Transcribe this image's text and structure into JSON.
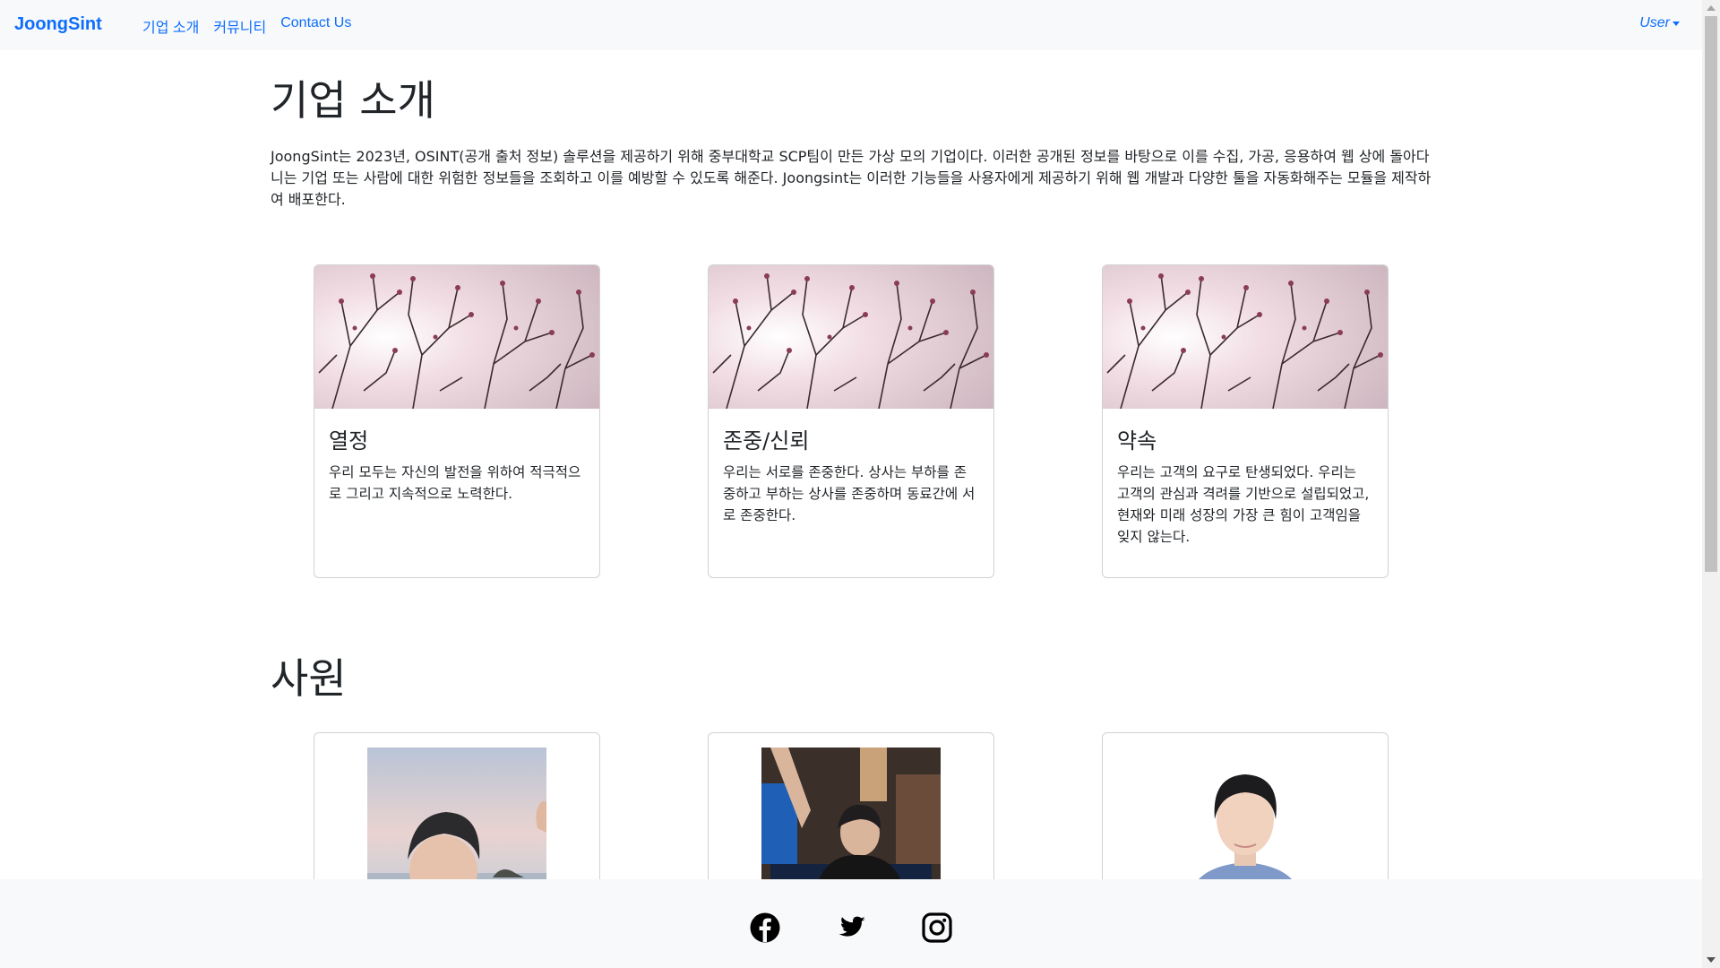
{
  "navbar": {
    "brand": "JoongSint",
    "links": [
      "기업 소개",
      "커뮤니티",
      "Contact Us"
    ],
    "user_label": "User"
  },
  "about": {
    "title": "기업 소개",
    "intro": "JoongSint는 2023년, OSINT(공개 출처 정보) 솔루션을 제공하기 위해 중부대학교 SCP팀이 만든 가상 모의 기업이다. 이러한 공개된 정보를 바탕으로 이를 수집, 가공, 응용하여 웹 상에 돌아다니는 기업 또는 사람에 대한 위험한 정보들을 조회하고 이를 예방할 수 있도록 해준다. Joongsint는 이러한 기능들을 사용자에게 제공하기 위해 웹 개발과 다양한 툴을 자동화해주는 모듈을 제작하여 배포한다."
  },
  "values": [
    {
      "title": "열정",
      "text": "우리 모두는 자신의 발전을 위하여 적극적으로 그리고 지속적으로 노력한다."
    },
    {
      "title": "존중/신뢰",
      "text": "우리는 서로를 존중한다. 상사는 부하를 존중하고 부하는 상사를 존중하며 동료간에 서로 존중한다."
    },
    {
      "title": "약속",
      "text": "우리는 고객의 요구로 탄생되었다. 우리는 고객의 관심과 격려를 기반으로 설립되었고, 현재와 미래 성장의 가장 큰 힘이 고객임을 잊지 않는다."
    }
  ],
  "staff": {
    "title": "사원"
  },
  "footer": {
    "icons": [
      "facebook-icon",
      "twitter-icon",
      "instagram-icon"
    ]
  },
  "colors": {
    "link": "#0d6efd",
    "navbar_bg": "#f8f9fa"
  }
}
